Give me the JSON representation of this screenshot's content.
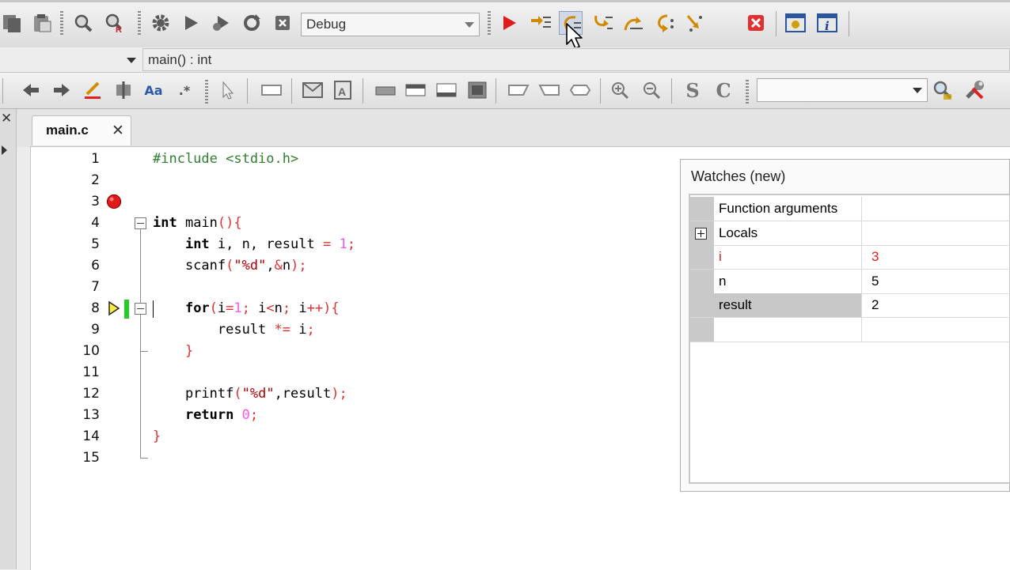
{
  "toolbar": {
    "build_target": "Debug"
  },
  "function_bar": {
    "scope_value": "",
    "function_value": "main() : int"
  },
  "editor_toolbar": {
    "search_value": ""
  },
  "tabs": [
    {
      "label": "main.c",
      "close": "✕"
    }
  ],
  "editor": {
    "line_numbers": [
      "1",
      "2",
      "3",
      "4",
      "5",
      "6",
      "7",
      "8",
      "9",
      "10",
      "11",
      "12",
      "13",
      "14",
      "15"
    ],
    "breakpoint_line": 3,
    "current_line": 8
  },
  "watches": {
    "title": "Watches (new)",
    "rows": [
      {
        "name": "Function arguments",
        "value": ""
      },
      {
        "name": "Locals",
        "value": ""
      },
      {
        "name": "i",
        "value": "3"
      },
      {
        "name": "n",
        "value": "5"
      },
      {
        "name": "result",
        "value": "2"
      }
    ]
  },
  "colors": {
    "breakpoint": "#e01b1b",
    "current_line_marker": "#22cc22",
    "changed_value": "#e02020",
    "keyword_symbol": "#e63030",
    "number_literal": "#ff55ff",
    "preprocessor": "#2f7f2f"
  }
}
